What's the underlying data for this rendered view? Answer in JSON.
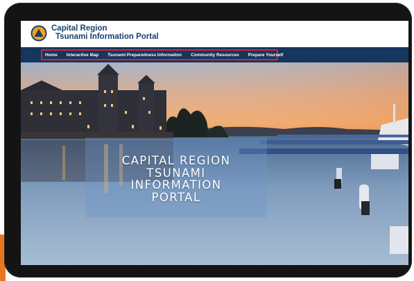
{
  "site": {
    "title_line1": "Capital Region",
    "title_line2": "Tsunami Information Portal"
  },
  "nav": {
    "items": [
      {
        "label": "Home"
      },
      {
        "label": "Interactive Map"
      },
      {
        "label": "Tsunami Preparedness Information"
      },
      {
        "label": "Community Resources"
      },
      {
        "label": "Prepare Yourself"
      }
    ]
  },
  "hero": {
    "lines": [
      "CAPITAL REGION",
      "TSUNAMI",
      "INFORMATION",
      "PORTAL"
    ]
  },
  "colors": {
    "brand_navy": "#15365f",
    "title_blue": "#1a3f6e",
    "logo_orange": "#f4a21a",
    "highlight_red": "#e0202a",
    "accent_orange": "#e8761e"
  },
  "icons": {
    "logo": "tsunami-triangle-logo-icon"
  }
}
